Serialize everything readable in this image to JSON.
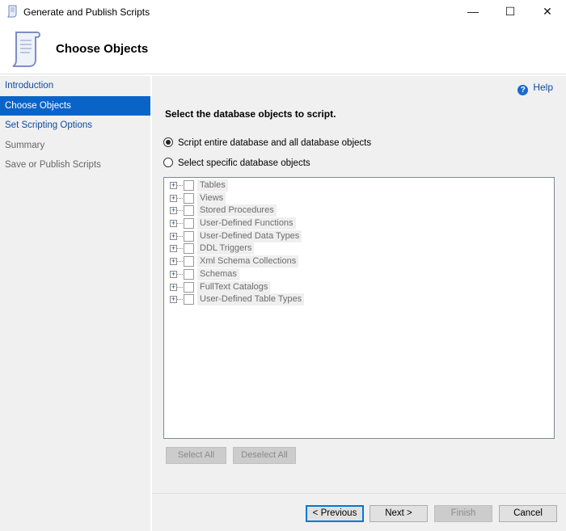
{
  "window": {
    "title": "Generate and Publish Scripts",
    "minimize": "—",
    "maximize": "☐",
    "close": "✕"
  },
  "header": {
    "title": "Choose Objects"
  },
  "nav": {
    "items": [
      {
        "label": "Introduction",
        "state": "link"
      },
      {
        "label": "Choose Objects",
        "state": "selected"
      },
      {
        "label": "Set Scripting Options",
        "state": "link"
      },
      {
        "label": "Summary",
        "state": "disabled"
      },
      {
        "label": "Save or Publish Scripts",
        "state": "disabled"
      }
    ]
  },
  "main": {
    "help": "Help",
    "prompt": "Select the database objects to script.",
    "radio_all": "Script entire database and all database objects",
    "radio_specific": "Select specific database objects",
    "selected_radio": "all",
    "tree": [
      "Tables",
      "Views",
      "Stored Procedures",
      "User-Defined Functions",
      "User-Defined Data Types",
      "DDL Triggers",
      "Xml Schema Collections",
      "Schemas",
      "FullText Catalogs",
      "User-Defined Table Types"
    ],
    "select_all": "Select All",
    "deselect_all": "Deselect All"
  },
  "footer": {
    "previous": "< Previous",
    "next": "Next >",
    "finish": "Finish",
    "cancel": "Cancel"
  }
}
